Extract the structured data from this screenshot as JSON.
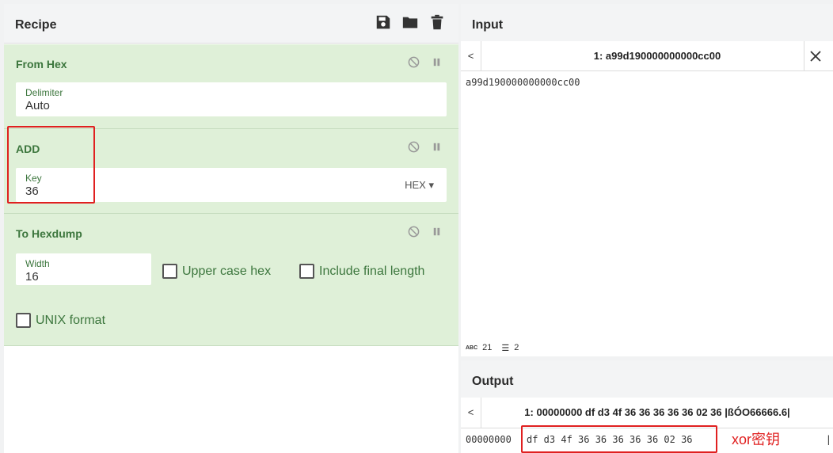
{
  "recipe": {
    "title": "Recipe",
    "toolbar": [
      "save-icon",
      "folder-icon",
      "trash-icon"
    ],
    "operations": [
      {
        "name": "From Hex",
        "fields": [
          {
            "label": "Delimiter",
            "value": "Auto"
          }
        ]
      },
      {
        "name": "ADD",
        "fields": [
          {
            "label": "Key",
            "value": "36",
            "format": "HEX"
          }
        ],
        "highlighted": true
      },
      {
        "name": "To Hexdump",
        "fields": [
          {
            "label": "Width",
            "value": "16"
          }
        ],
        "checkboxes": [
          {
            "label": "Upper case hex",
            "checked": false
          },
          {
            "label": "Include final length",
            "checked": false
          },
          {
            "label": "UNIX format",
            "checked": false
          }
        ]
      }
    ]
  },
  "input": {
    "title": "Input",
    "tab_prev": "<",
    "tab_label": "1: a99d190000000000cc00",
    "text": "a99d190000000000cc00",
    "status": {
      "chars": "21",
      "lines": "2"
    }
  },
  "output": {
    "title": "Output",
    "tab_prev": "<",
    "tab_label": "1: 00000000 df d3 4f 36 36 36 36 36 02 36 |ßÓO66666.6|",
    "offset": "00000000",
    "hex": "df d3 4f 36 36 36 36 36 02 36",
    "trail": "|",
    "annotation": "xor密钥"
  },
  "colors": {
    "op_bg": "#dff0d8",
    "op_text": "#3c763d",
    "highlight": "#e02020"
  }
}
